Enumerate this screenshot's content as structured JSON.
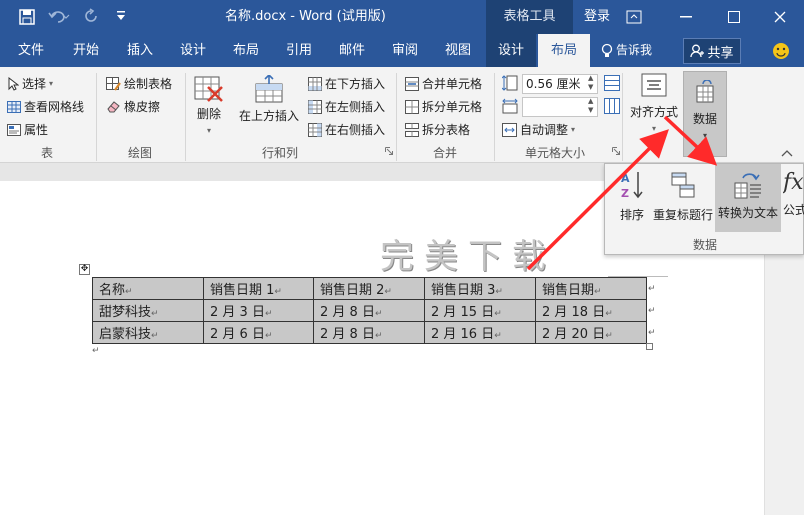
{
  "title_bar": {
    "doc_title": "名称.docx - Word (试用版)",
    "context_group": "表格工具",
    "login": "登录"
  },
  "tabs": [
    {
      "label": "文件"
    },
    {
      "label": "开始"
    },
    {
      "label": "插入"
    },
    {
      "label": "设计"
    },
    {
      "label": "布局"
    },
    {
      "label": "引用"
    },
    {
      "label": "邮件"
    },
    {
      "label": "审阅"
    },
    {
      "label": "视图"
    },
    {
      "label": "设计"
    },
    {
      "label": "布局"
    }
  ],
  "tell_me": "告诉我",
  "share": "共享",
  "ribbon": {
    "table": {
      "select": "选择",
      "gridlines": "查看网格线",
      "properties": "属性",
      "label": "表"
    },
    "draw": {
      "draw_table": "绘制表格",
      "eraser": "橡皮擦",
      "label": "绘图"
    },
    "rows_cols": {
      "delete": "删除",
      "insert_above": "在上方插入",
      "insert_below": "在下方插入",
      "insert_left": "在左侧插入",
      "insert_right": "在右侧插入",
      "label": "行和列"
    },
    "merge": {
      "merge_cells": "合并单元格",
      "split_cells": "拆分单元格",
      "split_table": "拆分表格",
      "label": "合并"
    },
    "cell_size": {
      "height_value": "0.56 厘米",
      "auto_fit": "自动调整",
      "label": "单元格大小"
    },
    "alignment": "对齐方式",
    "data": "数据"
  },
  "data_panel": {
    "sort": "排序",
    "repeat_header": "重复标题行",
    "convert_to_text": "转换为文本",
    "formula": "公式",
    "label": "数据"
  },
  "watermark": "完美下载",
  "doc_table": {
    "rows": [
      [
        "名称",
        "销售日期 1",
        "销售日期 2",
        "销售日期 3",
        "销售日期"
      ],
      [
        "甜梦科技",
        "2 月 3 日",
        "2 月 8 日",
        "2 月 15 日",
        "2 月 18 日"
      ],
      [
        "启蒙科技",
        "2 月 6 日",
        "2 月 8 日",
        "2 月 16 日",
        "2 月 20 日"
      ]
    ]
  }
}
